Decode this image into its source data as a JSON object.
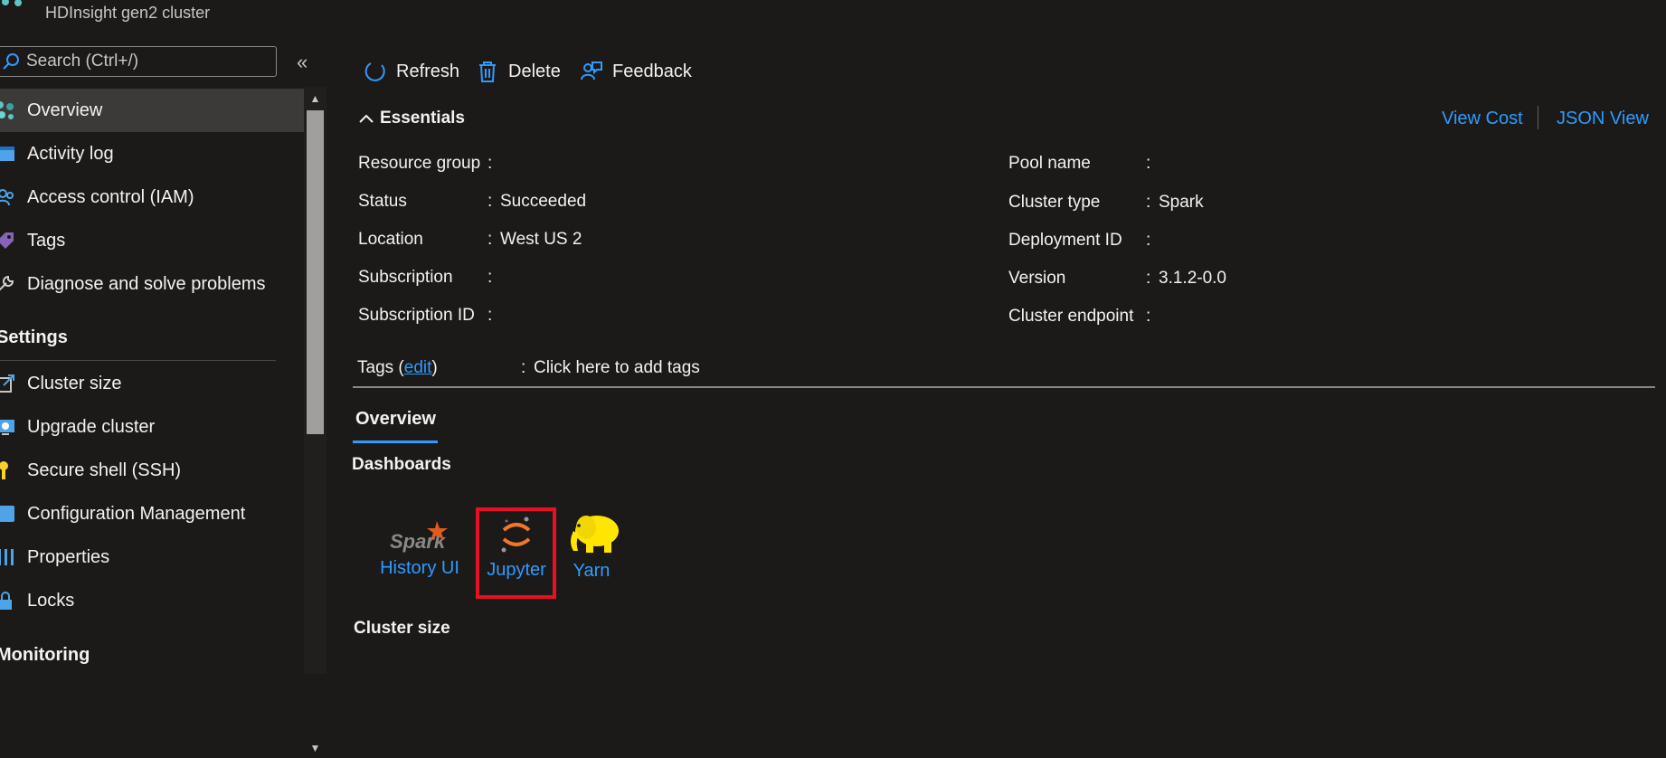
{
  "header": {
    "subtitle": "HDInsight gen2 cluster"
  },
  "sidebar": {
    "search_placeholder": "Search (Ctrl+/)",
    "collapse_glyph": "«",
    "items_top": [
      {
        "label": "Overview",
        "icon": "cluster-icon",
        "active": true
      },
      {
        "label": "Activity log",
        "icon": "activity-log-icon"
      },
      {
        "label": "Access control (IAM)",
        "icon": "iam-icon"
      },
      {
        "label": "Tags",
        "icon": "tag-icon"
      },
      {
        "label": "Diagnose and solve problems",
        "icon": "wrench-icon"
      }
    ],
    "settings_header": "Settings",
    "items_settings": [
      {
        "label": "Cluster size",
        "icon": "resize-icon"
      },
      {
        "label": "Upgrade cluster",
        "icon": "upgrade-icon"
      },
      {
        "label": "Secure shell (SSH)",
        "icon": "key-icon"
      },
      {
        "label": "Configuration Management",
        "icon": "config-icon"
      },
      {
        "label": "Properties",
        "icon": "properties-icon"
      },
      {
        "label": "Locks",
        "icon": "lock-icon"
      }
    ],
    "monitoring_header": "Monitoring"
  },
  "toolbar": {
    "refresh": "Refresh",
    "delete": "Delete",
    "feedback": "Feedback"
  },
  "essentials": {
    "title": "Essentials",
    "view_cost": "View Cost",
    "json_view": "JSON View",
    "left": [
      {
        "label": "Resource group",
        "value": ""
      },
      {
        "label": "Status",
        "value": "Succeeded"
      },
      {
        "label": "Location",
        "value": "West US 2"
      },
      {
        "label": "Subscription",
        "value": ""
      },
      {
        "label": "Subscription ID",
        "value": ""
      }
    ],
    "right": [
      {
        "label": "Pool name",
        "value": ""
      },
      {
        "label": "Cluster type",
        "value": "Spark"
      },
      {
        "label": "Deployment ID",
        "value": ""
      },
      {
        "label": "Version",
        "value": "3.1.2-0.0"
      },
      {
        "label": "Cluster endpoint",
        "value": ""
      }
    ],
    "tags_label": "Tags (",
    "tags_edit": "edit",
    "tags_close": ")",
    "tags_value": "Click here to add tags",
    "colon": ":"
  },
  "tabs": {
    "overview": "Overview"
  },
  "dashboards": {
    "heading": "Dashboards",
    "items": [
      {
        "label": "History UI",
        "icon": "spark-logo-icon",
        "logo_text": "Spark"
      },
      {
        "label": "Jupyter",
        "icon": "jupyter-logo-icon"
      },
      {
        "label": "Yarn",
        "icon": "hadoop-elephant-icon"
      }
    ]
  },
  "cluster_size_heading": "Cluster size",
  "colors": {
    "link": "#2f9bff",
    "background": "#1b1a19",
    "highlight": "#e81123"
  }
}
